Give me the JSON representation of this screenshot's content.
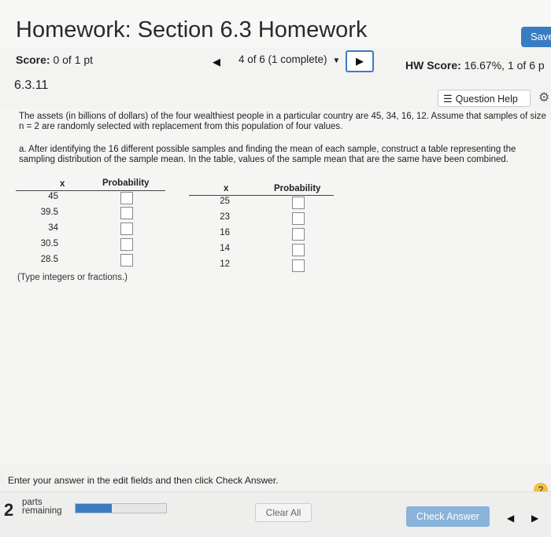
{
  "header": {
    "title": "Homework: Section 6.3 Homework",
    "save_label": "Save"
  },
  "scorebar": {
    "score_label": "Score:",
    "score_value": "0 of 1 pt",
    "progress": "4 of 6 (1 complete)",
    "hw_score_label": "HW Score:",
    "hw_score_value": "16.67%, 1 of 6 p"
  },
  "question": {
    "number": "6.3.11",
    "help_label": "Question Help"
  },
  "prompt": "The assets (in billions of dollars) of the four wealthiest people in a particular country are 45, 34, 16, 12. Assume that samples of size n = 2 are randomly selected with replacement from this population of four values.",
  "part_a": "a. After identifying the 16 different possible samples and finding the mean of each sample, construct a table representing the sampling distribution of the sample mean. In the table, values of the sample mean that are the same have been combined.",
  "table": {
    "x_header": "x",
    "prob_header": "Probability",
    "left_x": [
      "45",
      "39.5",
      "34",
      "30.5",
      "28.5"
    ],
    "right_x": [
      "25",
      "23",
      "16",
      "14",
      "12"
    ]
  },
  "note": "(Type integers or fractions.)",
  "instructions": "Enter your answer in the edit fields and then click Check Answer.",
  "footer": {
    "parts_count": "2",
    "parts_label_1": "parts",
    "parts_label_2": "remaining",
    "progress_fraction": 0.4,
    "clear_label": "Clear All",
    "check_label": "Check Answer"
  },
  "colors": {
    "accent": "#3a7cc2",
    "check_button": "#8ab3db"
  },
  "icons": [
    "caret-left-icon",
    "caret-down-icon",
    "caret-right-icon",
    "list-icon",
    "gear-icon",
    "help-icon"
  ]
}
